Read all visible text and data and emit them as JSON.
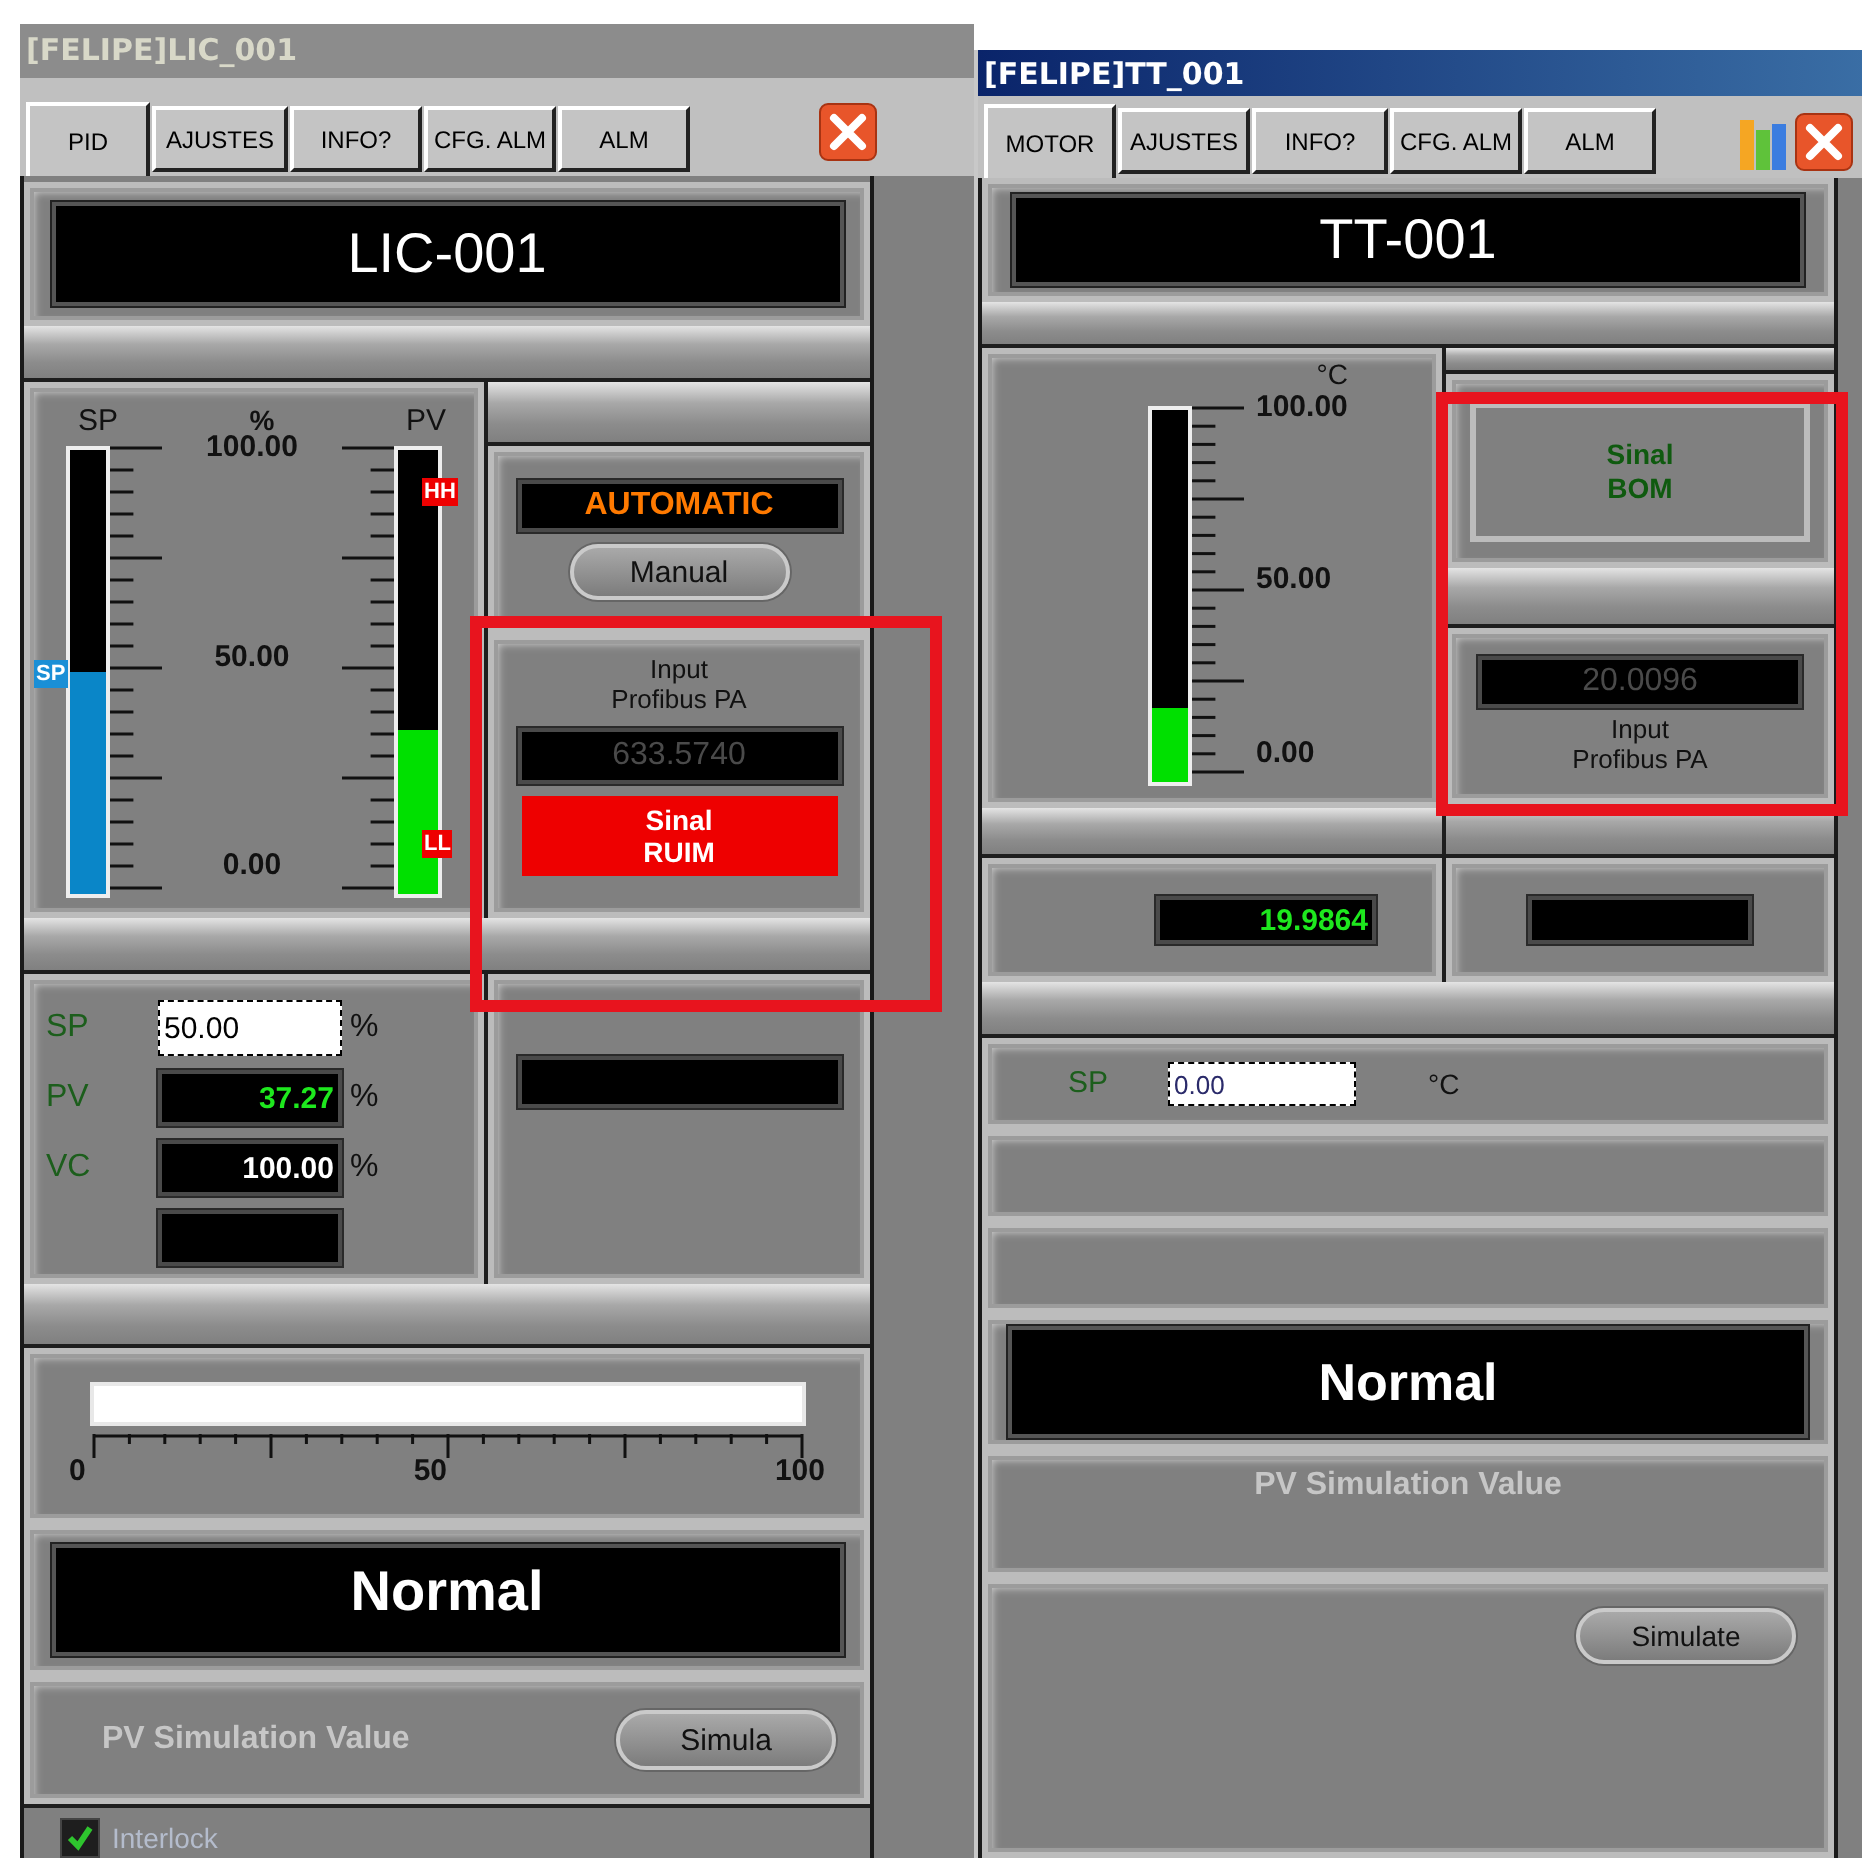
{
  "lic_faceplate": {
    "title": "[FELIPE]LIC_001",
    "tabs": [
      {
        "label": "PID",
        "selected": true
      },
      {
        "label": "AJUSTES",
        "selected": false
      },
      {
        "label": "INFO?",
        "selected": false
      },
      {
        "label": "CFG. ALM",
        "selected": false
      },
      {
        "label": "ALM",
        "selected": false
      }
    ],
    "tag": "LIC-001",
    "bargraph": {
      "sp_label": "SP",
      "unit": "%",
      "pv_label": "PV",
      "ticks": [
        "100.00",
        "50.00",
        "0.00"
      ],
      "sp_bar": {
        "level": 0.5
      },
      "sp_marker": "SP",
      "pv_bar": {
        "level": 0.3727
      },
      "hh_marker": "HH",
      "ll_marker": "LL"
    },
    "mode": {
      "status": "AUTOMATIC",
      "button": "Manual"
    },
    "input": {
      "lines": [
        "Input",
        "Profibus PA"
      ],
      "value": "633.5740"
    },
    "signal": {
      "lines": [
        "Sinal",
        "RUIM"
      ],
      "ok": false
    },
    "values": [
      {
        "kind": "input",
        "label": "SP",
        "value": "50.00",
        "unit": "%"
      },
      {
        "kind": "pv",
        "label": "PV",
        "value": "37.27",
        "unit": "%"
      },
      {
        "kind": "readout",
        "label": "VC",
        "value": "100.00",
        "unit": "%"
      },
      {
        "kind": "blank"
      }
    ],
    "output_scale": {
      "level": 1,
      "ticks": [
        "0",
        "50",
        "100"
      ]
    },
    "alarm_status": "Normal",
    "simulation": {
      "label": "PV Simulation Value",
      "disabled": true,
      "button": "Simula"
    },
    "interlock": {
      "label": "Interlock",
      "checked": true
    }
  },
  "tt_faceplate": {
    "title": "[FELIPE]TT_001",
    "tabs": [
      {
        "label": "MOTOR",
        "selected": true
      },
      {
        "label": "AJUSTES",
        "selected": false
      },
      {
        "label": "INFO?",
        "selected": false
      },
      {
        "label": "CFG. ALM",
        "selected": false
      },
      {
        "label": "ALM",
        "selected": false
      }
    ],
    "tag": "TT-001",
    "thermometer": {
      "unit": "°C",
      "ticks": [
        "100.00",
        "50.00",
        "0.00"
      ],
      "level": 0.2
    },
    "signal": {
      "lines": [
        "Sinal",
        "BOM"
      ],
      "ok": true
    },
    "input": {
      "lines": [
        "Input",
        "Profibus PA"
      ],
      "value": "20.0096"
    },
    "pv_readout": "19.9864",
    "sp": {
      "label": "SP",
      "value": "0.00",
      "unit": "°C"
    },
    "alarm_status": "Normal",
    "simulation": {
      "label": "PV Simulation Value",
      "disabled": true
    },
    "simulate_button": "Simulate"
  }
}
